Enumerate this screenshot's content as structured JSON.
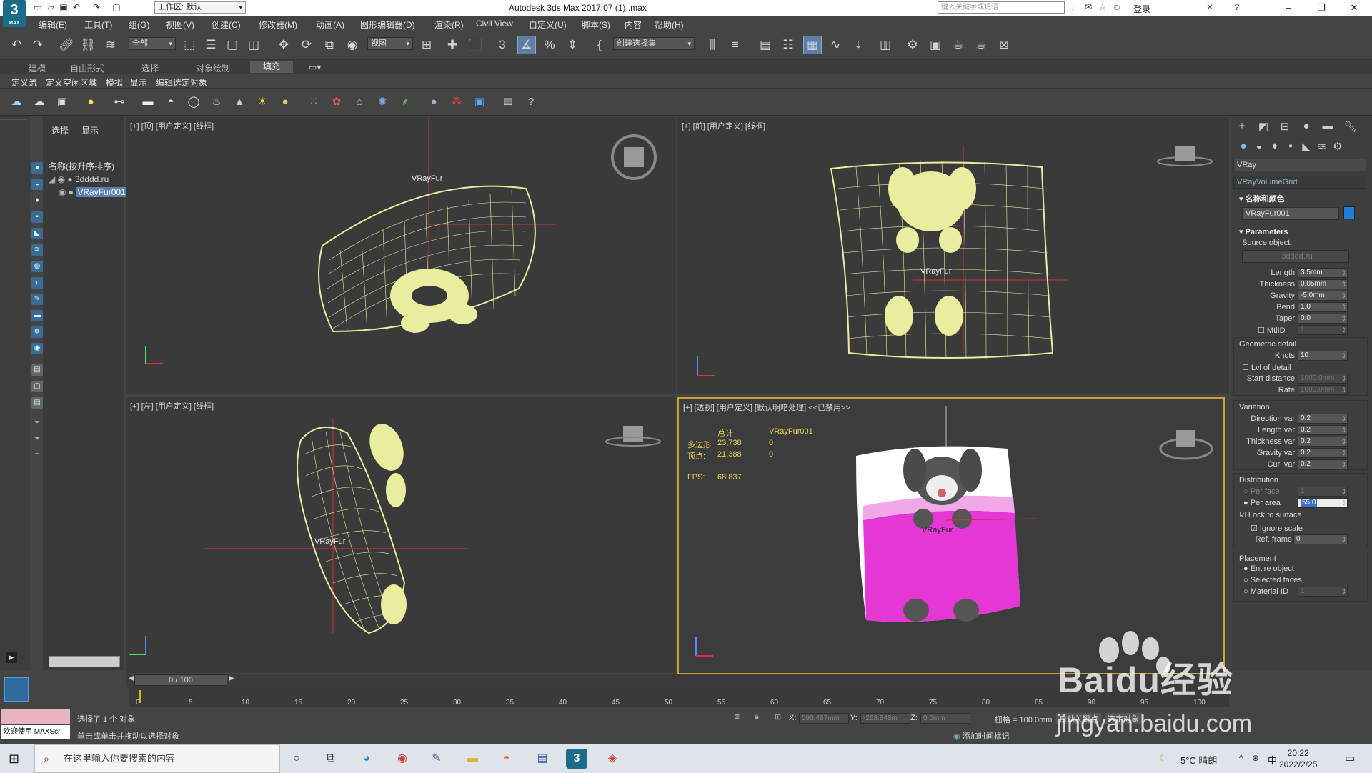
{
  "app": {
    "logo_text": "3",
    "logo_sub": "MAX",
    "window_title": "Autodesk 3ds Max 2017     07  (1)  .max",
    "workspace_label": "工作区: 默认",
    "search_placeholder": "键入关键字或短语",
    "login_label": "登录"
  },
  "menu": [
    "编辑(E)",
    "工具(T)",
    "组(G)",
    "视图(V)",
    "创建(C)",
    "修改器(M)",
    "动画(A)",
    "图形编辑器(D)",
    "渲染(R)",
    "Civil View",
    "自定义(U)",
    "脚本(S)",
    "内容",
    "帮助(H)"
  ],
  "toolbar": {
    "selection_filter": "全部",
    "ref_coord": "视图",
    "named_selection": "创建选择集"
  },
  "ribbon": {
    "tabs": [
      "建模",
      "自由形式",
      "选择",
      "对象绘制",
      "填充"
    ],
    "active_tab": "填充",
    "sub_items": [
      "定义流",
      "定义空闲区域",
      "模拟",
      "显示",
      "编辑选定对象"
    ]
  },
  "scene_explorer": {
    "tabs": [
      "选择",
      "显示"
    ],
    "header": "名称(按升序排序)",
    "rows": [
      "3dddd.ru",
      "VRayFur001"
    ],
    "selected_row": "VRayFur001"
  },
  "viewports": {
    "top": {
      "label": "[+] [顶] [用户定义] [线框]",
      "object_label": "VRayFur"
    },
    "front": {
      "label": "[+] [前] [用户定义] [线框]",
      "object_label": "VRayFur"
    },
    "left": {
      "label": "[+] [左] [用户定义] [线框]",
      "object_label": "VRayFur"
    },
    "persp": {
      "label": "[+] [透视] [用户定义] [默认明暗处理] <<已禁用>>",
      "object_label": "VRayFur",
      "stats": {
        "col_total": "总计",
        "col_object": "VRayFur001",
        "polys_label": "多边形:",
        "polys_total": "23,738",
        "polys_obj": "0",
        "verts_label": "顶点:",
        "verts_total": "21,388",
        "verts_obj": "0",
        "fps_label": "FPS:",
        "fps_value": "68.837"
      }
    }
  },
  "command_panel": {
    "renderer": "VRay",
    "object_type": "VRayVolumeGrid",
    "name_color_title": "名称和颜色",
    "object_name": "VRayFur001",
    "object_color": "#1e7fd6",
    "parameters_title": "Parameters",
    "source_object_label": "Source object:",
    "source_object_value": "3dddd.ru",
    "params": [
      {
        "label": "Length",
        "value": "3.5mm"
      },
      {
        "label": "Thickness",
        "value": "0.05mm"
      },
      {
        "label": "Gravity",
        "value": "-5.0mm"
      },
      {
        "label": "Bend",
        "value": "1.0"
      },
      {
        "label": "Taper",
        "value": "0.0"
      },
      {
        "label": "MtlID",
        "value": "1"
      }
    ],
    "geometric_detail_title": "Geometric detail",
    "knots_label": "Knots",
    "knots_value": "10",
    "lvl_of_detail_label": "Lvl of detail",
    "start_distance_label": "Start distance",
    "start_distance_value": "1000.0mm",
    "rate_label": "Rate",
    "rate_value": "1000.0mm",
    "variation_title": "Variation",
    "variation": [
      {
        "label": "Direction var",
        "value": "0.2"
      },
      {
        "label": "Length var",
        "value": "0.2"
      },
      {
        "label": "Thickness var",
        "value": "0.2"
      },
      {
        "label": "Gravity var",
        "value": "0.2"
      },
      {
        "label": "Curl var",
        "value": "0.2"
      }
    ],
    "distribution_title": "Distribution",
    "per_face_label": "Per face",
    "per_face_value": "1",
    "per_area_label": "Per area",
    "per_area_value": "55.0",
    "lock_surface_label": "Lock to surface",
    "ignore_scale_label": "Ignore scale",
    "ref_frame_label": "Ref. frame",
    "ref_frame_value": "0",
    "placement_title": "Placement",
    "entire_object_label": "Entire object",
    "selected_faces_label": "Selected faces",
    "material_id_label": "Material ID",
    "material_id_value": "1"
  },
  "timeline": {
    "frame_display": "0 / 100",
    "ticks": [
      "0",
      "5",
      "10",
      "15",
      "20",
      "25",
      "30",
      "35",
      "40",
      "45",
      "50",
      "55",
      "60",
      "65",
      "70",
      "75",
      "80",
      "85",
      "90",
      "95",
      "100"
    ]
  },
  "status": {
    "maxscript_prompt": "欢迎使用 MAXScr",
    "selection_msg": "选择了 1 个 对象",
    "hint_msg": "单击或单击并拖动以选择对象",
    "x_label": "X:",
    "x_value": "590.487mm",
    "y_label": "Y:",
    "y_value": "-268.848m",
    "z_label": "Z:",
    "z_value": "0.0mm",
    "grid_label": "栅格 = 100.0mm",
    "add_time_tag": "添加时间标记",
    "auto_key": "自动关键点",
    "set_key": "选定对象"
  },
  "taskbar": {
    "search_placeholder": "在这里输入你要搜索的内容",
    "weather": "5°C  晴朗",
    "lang": "中",
    "time": "20:22",
    "date": "2022/2/25"
  },
  "watermark": {
    "brand": "Baidu经验",
    "url": "jingyan.baidu.com"
  }
}
